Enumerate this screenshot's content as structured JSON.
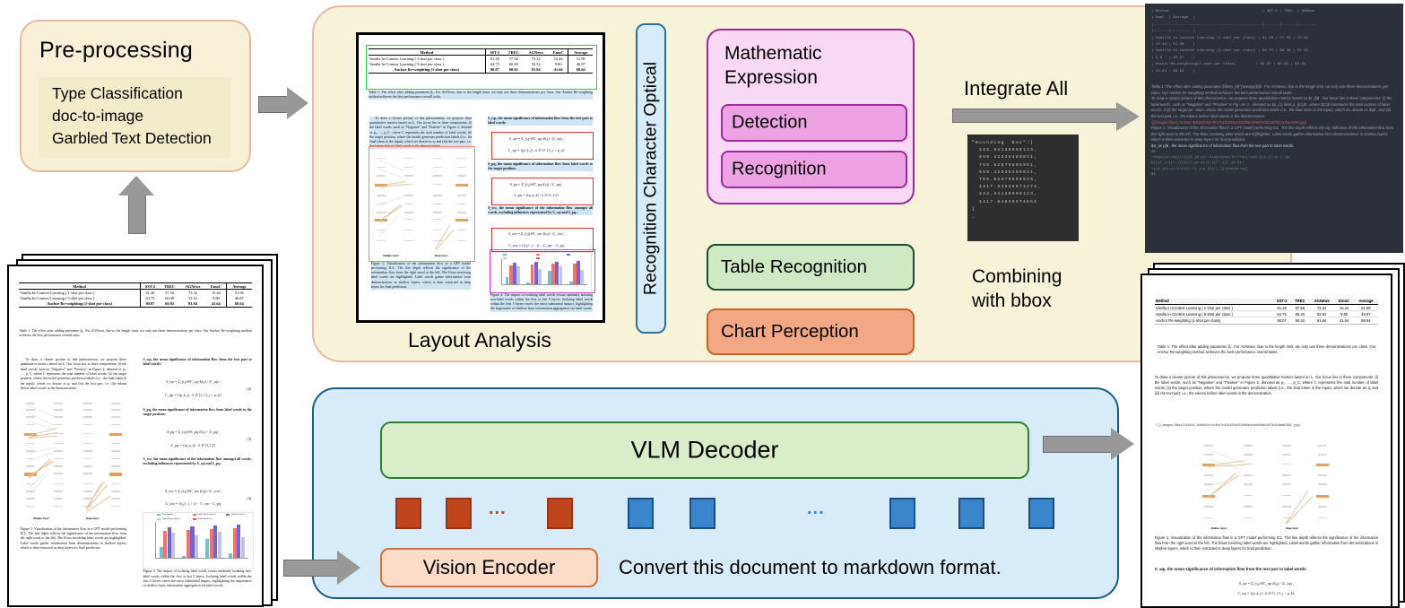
{
  "preprocessing": {
    "title": "Pre-processing",
    "items": [
      "Type Classification",
      "doc-to-image",
      "Garbled Text Detection"
    ]
  },
  "layout_analysis": {
    "label": "Layout Analysis"
  },
  "ocr": {
    "vertical_label": "Recognition Character Optical",
    "math_box": {
      "title_line1": "Mathematic",
      "title_line2": "Expression",
      "detection": "Detection",
      "recognition": "Recognition"
    },
    "table_recognition": "Table Recognition",
    "chart_perception": "Chart Perception"
  },
  "integrate": {
    "label": "Integrate All",
    "combine_line1": "Combining",
    "combine_line2": "with bbox",
    "code": "\"Bounding  box\":[\n  242.94139099123,\n  659.42535480031,\n  765.62675595981,\n  659.42535480031,\n  765.62670599845,\n  1417.84538574271,\n  242.94139099123,\n  1417.84635574851\n]\n_"
  },
  "vlm": {
    "decoder": "VLM Decoder",
    "vision_encoder": "Vision Encoder",
    "prompt": "Convert this document to markdown format.",
    "dots": "..."
  },
  "document": {
    "table": {
      "headers": [
        "Method",
        "SST-2",
        "TREC",
        "AGNews",
        "EmoC",
        "Average"
      ],
      "rows": [
        [
          "Vanilla In-Context Learning ( 1-shot per class )",
          "61.28",
          "57.56",
          "73.32",
          "15.44",
          "51.90"
        ],
        [
          "Vanilla In-Context Learning ( 5-shot per class )",
          "64.75",
          "60.40",
          "52.52",
          "9.80",
          "46.87"
        ],
        [
          "Anchor Re-weighting (1-shot per class)",
          "90.07",
          "60.92",
          "81.94",
          "41.64",
          "68.64"
        ]
      ]
    },
    "table_caption": "Table 1: The effect after adding parameter β₀. For AGNews, due to the length limit, we only use three demonstrations per class. Our Anchor Re-weighting method achieves the best performance overall tasks.",
    "body_paragraph": "To draw a clearer picture of this phenomenon, we propose three quantitative metrics based on I₁. Our focus lies in three components: (i) the label words, such as \"Negative\" and \"Positive\" in Figure 2, denoted as p₁, …, p_C, where C represents the total number of label words; (ii) the target position, where the model generates prediction labels (i.e., the final token in the input), which we denote as q; and (iii) the text part, i.e., the tokens before label words in the demonstration.",
    "eq_head_1": "S_wp, the mean significance of information flow from the text part to label words:",
    "eq_1": "S_wp = Σ_(i,j)∈C_wp I(i,j) / |C_wp| ,",
    "eq_1b": "C_wp = {(p_k, j) : k ∈ [1, C], j < p_k}.",
    "eq_num_1": "(2)",
    "eq_head_2": "S_pq, the mean significance of information flow from label words to the target position:",
    "eq_2": "S_pq = Σ_(i,j)∈C_pq I(i,j) / |C_pq| ,",
    "eq_2b": "C_pq = {(q, p_k) : k ∈ [1, C]}.",
    "eq_num_2": "(3)",
    "eq_head_3": "S_ww, the mean significance of the information flow amongst all words, excluding influences represented by S_wp and S_pq :",
    "eq_3": "S_ww = Σ_(i,j)∈C_ww I(i,j) / |C_ww| ,",
    "eq_3b": "C_ww = {(i,j) : j < i} − C_wp − C_pq.",
    "eq_num_3": "(4)",
    "fig1_caption": "Figure 1: Visualization of the information flow in a GPT model performing ICL. The line depth reflects the significance of the information flow from the right word to the left. The flows involving label words are highlighted. Label words gather information from demonstrations in shallow layers, which is then extracted in deep layers for final prediction.",
    "fig4_caption": "Figure 4: The impact of isolating label words versus randomly isolating non-label words within the first or last 5 layers. Isolating label words within the first 5 layers exerts the most substantial impact, highlighting the importance of shallow-layer information aggregation via label words.",
    "fig1_shallow_label": "Shallow layer",
    "fig1_deep_label": "Deep layer"
  },
  "markdown_output": {
    "table_md": "| Method                                           | SST-2 | TREC  | AGNews\n| EmoC  | Average  |\n|--------------------------------------------------|-------|-------|--------\n|------ |--------- |\n| Vanilla In-Context Learning (1-shot per class) | 61.28 | 57.56 | 73.32\n| 15.44 | 51.90    |\n| Vanilla In-Context Learning (5-shot per class) | 64.75 | 60.40 | 52.52\n| 9.8   | 46.87    |\n| Anchor Re-weighting(1-shot per class)         | 90.07 | 60.92 | 81.94\n| 41.64 | 68.64    |",
    "caption_md": "Table 1: The effect after adding parameter $\\beta_{0}^{\\wedge}{i}$ . For AGNews, due to the length limit, we only use three demonstrations per class. Our Anchor Re-weighting method achieves the best performance overall tasks.",
    "body_md": "To draw a clearer picture of this phenomenon, we propose three quantitative metrics based on $I_{l}$ . Our focus lies in three components: (i) the label words, such as \"Negative\" and \"Positive\" in Fig- ure 2 , denoted as $p_{1},\\dots,p_{|C|}$ , where $|C|$ represents the total number of label words: 4  (ii) the target po- sition, where the model generates prediction labels (i.e., the final token in the input), which we denote as $q$ , and (iii) the text part, i.e., the tokens before label words in the demonstration.",
    "image_ref": "![](images/2be117e3c84 9db0d2cf4c4017c431255e3520d5e4e9d45dd24d79c318aa5390.jpg)",
    "fig_md": "Figure 1: Visualization of the information flow in a GPT model performing ICL. The line depth reflects the sig- nificance of the information flow from the right word to the left. The flows involving label words are highlighted. Label words gather information from demonstrations in shallow layers, which is then extracted in deep layers for final prediction.",
    "eq_head_md": "$S_{w p}$ , the mean significance of information flow from the text part to label words:",
    "latex_md": "$$\n\\begin{array}{l}{{S_{w p}=\\displaystyle\\frac{\\sum_{(i,j)\\in C_{w\np}}{I_{l}(i,j)}}{|C_{w p}|},}}\\\\ {{C_{w p}=\n\\{(p_{k},j):k\\in[1,C],j<p_{k}\\}.}}\\end{array}\n$$"
  },
  "colors": {
    "panel_beige": "#f7f3d8",
    "panel_blue": "#d7ecf8",
    "pink": "#f8d9f5",
    "pink_dark": "#eda3e3",
    "green": "#cfe9c4",
    "orange": "#f2a885",
    "arrow_gray": "#989898",
    "token_red": "#c0441c",
    "token_blue": "#3a85cc",
    "ann_green": "#2ecc40",
    "ann_red": "#e03131",
    "ann_pink": "#d83fd8",
    "ann_orange": "#ef8a5a"
  }
}
